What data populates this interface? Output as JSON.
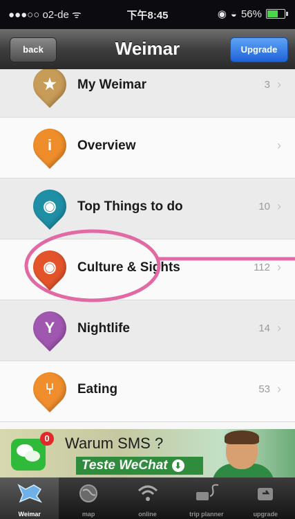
{
  "status_bar": {
    "carrier": "●●●○○ o2-de ᯤ",
    "time": "下午8:45",
    "battery_text": "56%"
  },
  "nav": {
    "back_label": "back",
    "title": "Weimar",
    "upgrade_label": "Upgrade"
  },
  "list": [
    {
      "label": "My Weimar",
      "count": "3",
      "icon": "star-pin-icon",
      "color": "#c79b58"
    },
    {
      "label": "Overview",
      "count": "",
      "icon": "info-pin-icon",
      "color": "#ef8d2a"
    },
    {
      "label": "Top Things to do",
      "count": "10",
      "icon": "eye-pin-icon",
      "color": "#1f8fa6"
    },
    {
      "label": "Culture & Sights",
      "count": "112",
      "icon": "eye-pin-icon",
      "color": "#e4542b"
    },
    {
      "label": "Nightlife",
      "count": "14",
      "icon": "cocktail-pin-icon",
      "color": "#a057b0"
    },
    {
      "label": "Eating",
      "count": "53",
      "icon": "cutlery-pin-icon",
      "color": "#f08d2c"
    }
  ],
  "annotation_color": "#e26aa4",
  "ad": {
    "badge": "0",
    "headline": "Warum SMS ?",
    "cta": "Teste WeChat"
  },
  "tabs": [
    {
      "label": "Weimar",
      "icon": "weimar-map-icon",
      "active": true
    },
    {
      "label": "map",
      "icon": "globe-icon",
      "active": false
    },
    {
      "label": "online",
      "icon": "wifi-icon",
      "active": false
    },
    {
      "label": "trip planner",
      "icon": "trip-planner-icon",
      "active": false
    },
    {
      "label": "upgrade",
      "icon": "upgrade-refresh-icon",
      "active": false
    }
  ]
}
